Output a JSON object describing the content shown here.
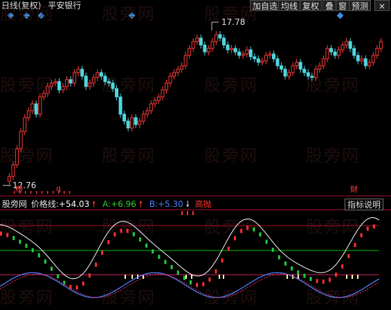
{
  "header": {
    "period": "日线",
    "adjust": "(复权)",
    "security": "平安银行",
    "buttons": [
      {
        "label": "加自选"
      },
      {
        "label": "均线"
      },
      {
        "label": "复权"
      },
      {
        "label": "叠"
      },
      {
        "label": "窗"
      },
      {
        "label": "预测"
      }
    ],
    "close_symbol": "×"
  },
  "watermark": "股旁网",
  "price_chart": {
    "high_label": "17.78",
    "low_label": "12.76",
    "marker_left": "榜",
    "marker_q": "q",
    "marker_right": "财"
  },
  "indicator": {
    "name": "股旁网",
    "main_label": "价格线:",
    "main_value": "+54.03",
    "a_label": "A:",
    "a_value": "+6.96",
    "b_label": "B:",
    "b_value": "+5.30",
    "signal_text": "高抛",
    "explain_button": "指标说明"
  },
  "colors": {
    "up": "#ff3b3b",
    "down": "#4fd8e0",
    "main_line": "#ffffff",
    "a_value": "#33cc33",
    "b_value": "#4f7fff",
    "signal": "#ff3030",
    "grid_red": "#aa1030",
    "mid_green": "#00c000"
  }
}
